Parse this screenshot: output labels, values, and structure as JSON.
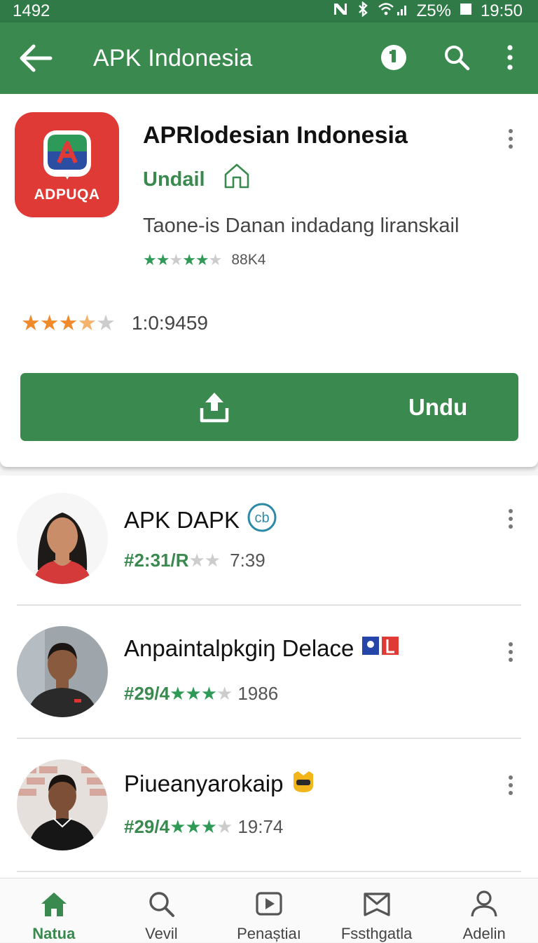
{
  "status_bar": {
    "time_left": "1492",
    "battery": "Z5%",
    "clock": "19:50"
  },
  "app_bar": {
    "title": "APK Indonesia"
  },
  "featured": {
    "logo_text": "ADPUQA",
    "title": "APRlodesian Indonesia",
    "subtitle": "Undail",
    "description": "Taone-is Danan indadang liranskail",
    "mini_rating": {
      "stars": 4,
      "count": "88K4"
    },
    "rating": {
      "stars": 3.5,
      "count": "1:0:9459"
    },
    "download_label": "Undu"
  },
  "list": [
    {
      "title": "APK DAPK",
      "badge": "cb",
      "code": "#2:31/R",
      "stars": 0,
      "time": "7:39"
    },
    {
      "title": "Anpaintalpkgiŋ Delace",
      "code": "#29/4",
      "stars": 3,
      "time": "1986"
    },
    {
      "title": "Piueanyarokaip",
      "code": "#29/4",
      "stars": 3,
      "time": "19:74"
    }
  ],
  "nav": [
    {
      "label": "Natua",
      "icon": "home-icon",
      "active": true
    },
    {
      "label": "Vevil",
      "icon": "search-icon"
    },
    {
      "label": "Penaștiaı",
      "icon": "play-icon"
    },
    {
      "label": "Fssthgatla",
      "icon": "mail-icon"
    },
    {
      "label": "Adelin",
      "icon": "person-icon"
    }
  ],
  "colors": {
    "primary": "#3a8a4f",
    "primary_dark": "#2f7a46",
    "logo_red": "#e03a36",
    "star_green": "#2f9a55",
    "star_orange": "#f08a2a"
  }
}
